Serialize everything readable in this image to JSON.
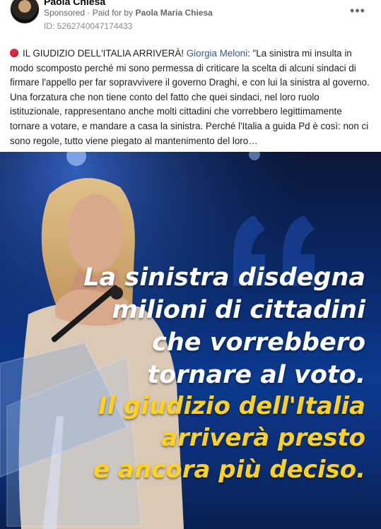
{
  "post": {
    "page_name": "Paola Chiesa",
    "sponsored_label": "Sponsored",
    "separator": "·",
    "paid_for_prefix": "Paid for by",
    "paid_for_name": "Paola Maria Chiesa",
    "ad_id": "ID: 5262740047174433",
    "more_icon": "more-horizontal-icon",
    "caption_lead": "IL GIUDIZIO DELL'ITALIA ARRIVERÀ!",
    "caption_mention": "Giorgia Meloni",
    "caption_body": ": \"La sinistra mi insulta in modo scomposto perché mi sono permessa di criticare la scelta di alcuni sindaci di firmare l'appello per far sopravvivere il governo Draghi, e con lui la sinistra al governo. Una forzatura che non tiene conto del fatto che quei sindaci, nel loro ruolo istituzionale, rappresentano anche molti cittadini che vorrebbero legittimamente tornare a votare, e mandare a casa la sinistra. Perché l'Italia a guida Pd è così: non ci sono regole, tutto viene piegato al mantenimento del loro…",
    "caption_icon": "red-circle-icon"
  },
  "image": {
    "lines_white": [
      "La sinistra disdegna",
      "milioni di cittadini",
      "che vorrebbero",
      "tornare al voto."
    ],
    "lines_yellow": [
      "Il giudizio dell'Italia",
      "arriverà presto",
      "e ancora più deciso."
    ],
    "colors": {
      "background": "#0c3a8f",
      "text_white": "#ffffff",
      "text_yellow": "#ffd21f"
    }
  }
}
